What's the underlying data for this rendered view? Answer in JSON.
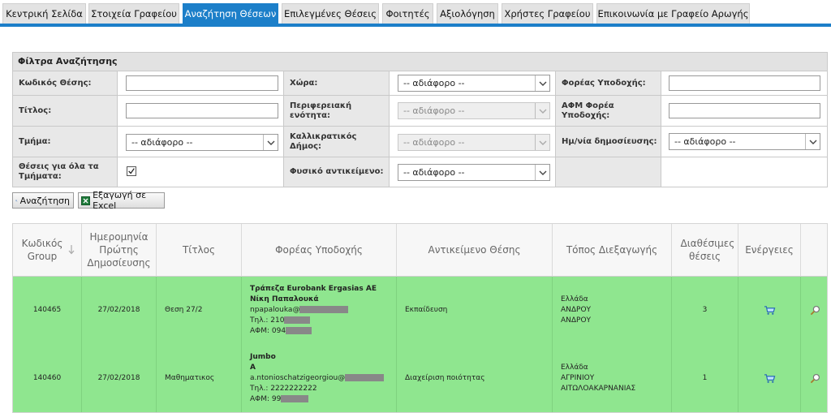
{
  "tabs": [
    {
      "label": "Κεντρική Σελίδα"
    },
    {
      "label": "Στοιχεία Γραφείου"
    },
    {
      "label": "Αναζήτηση Θέσεων"
    },
    {
      "label": "Επιλεγμένες Θέσεις"
    },
    {
      "label": "Φοιτητές"
    },
    {
      "label": "Αξιολόγηση"
    },
    {
      "label": "Χρήστες Γραφείου"
    },
    {
      "label": "Επικοινωνία με Γραφείο Αρωγής"
    }
  ],
  "filter": {
    "title": "Φίλτρα Αναζήτησης",
    "position_code_label": "Κωδικός Θέσης:",
    "country_label": "Χώρα:",
    "country_value": "-- αδιάφορο --",
    "host_label": "Φορέας Υποδοχής:",
    "title_label": "Τίτλος:",
    "region_label": "Περιφερειακή ενότητα:",
    "region_value": "-- αδιάφορο --",
    "host_afm_label": "ΑΦΜ Φορέα Υποδοχής:",
    "department_label": "Τμήμα:",
    "department_value": "-- αδιάφορο --",
    "municipality_label": "Καλλικρατικός Δήμος:",
    "municipality_value": "-- αδιάφορο --",
    "pub_date_label": "Ημ/νία δημοσίευσης:",
    "pub_date_value": "-- αδιάφορο --",
    "all_departments_label": "Θέσεις για όλα τα Τμήματα:",
    "all_departments_checked": true,
    "physical_object_label": "Φυσικό αντικείμενο:",
    "physical_object_value": "-- αδιάφορο --"
  },
  "buttons": {
    "search": "Αναζήτηση",
    "export": "Εξαγωγή σε Excel"
  },
  "table": {
    "headers": {
      "group_code": "Κωδικός Group",
      "first_pub_date": "Ημερομηνία Πρώτης Δημοσίευσης",
      "title": "Τίτλος",
      "host": "Φορέας Υποδοχής",
      "subject": "Αντικείμενο Θέσης",
      "location": "Τόπος Διεξαγωγής",
      "available": "Διαθέσιμες θέσεις",
      "actions": "Ενέργειες"
    },
    "rows": [
      {
        "group_code": "140465",
        "date": "27/02/2018",
        "title": "Θεση 27/2",
        "host_name": "Τράπεζα Eurobank Ergasias AE",
        "host_contact": "Νίκη Παπαλουκά",
        "email": "npapalouka@",
        "phone": "Τηλ.: 210",
        "afm": "ΑΦΜ: 094",
        "subject": "Εκπαίδευση",
        "location_1": "Ελλάδα",
        "location_2": "ΑΝΔΡΟΥ",
        "location_3": "ΑΝΔΡΟΥ",
        "available": "3"
      },
      {
        "group_code": "140460",
        "date": "27/02/2018",
        "title": "Μαθηματικος",
        "host_name": "Jumbo",
        "host_contact": "Α",
        "email": "a.ntonioschatzigeorgiou@",
        "phone": "Τηλ.: 2222222222",
        "afm": "ΑΦΜ: 99",
        "subject": "Διαχείριση ποιότητας",
        "location_1": "Ελλάδα",
        "location_2": "ΑΓΡΙΝΙΟΥ",
        "location_3": "ΑΙΤΩΛΟΑΚΑΡΝΑΝΙΑΣ",
        "available": "1"
      }
    ]
  },
  "colors": {
    "accent": "#1c7fc9",
    "row_highlight": "#8fe68f"
  }
}
